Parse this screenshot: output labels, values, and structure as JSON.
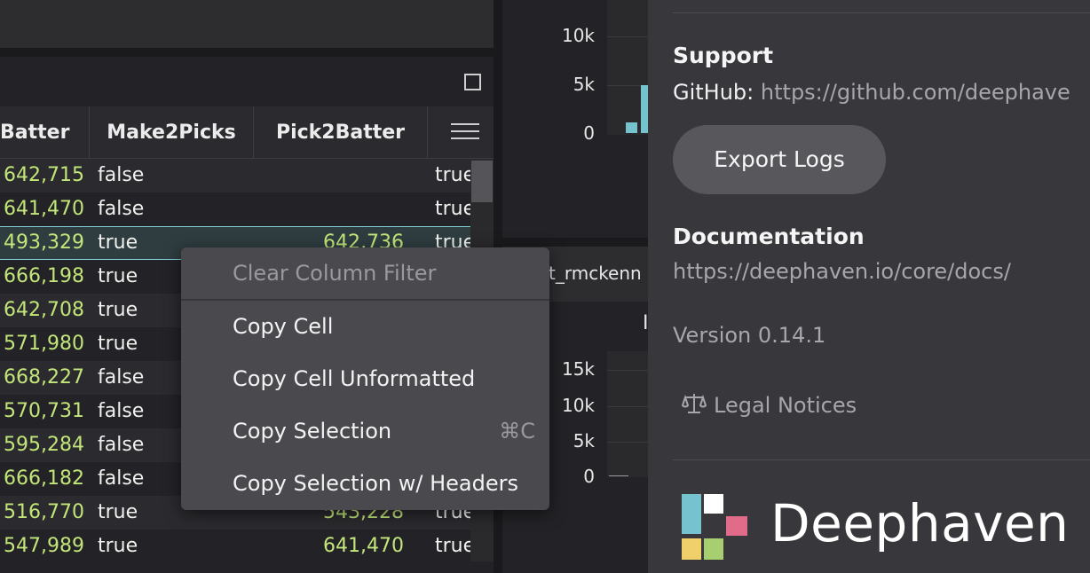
{
  "grid": {
    "columns": [
      "Batter",
      "Make2Picks",
      "Pick2Batter"
    ],
    "rows": [
      {
        "batter": "642,715",
        "make2picks": "false",
        "pick2batter": "",
        "last": "true"
      },
      {
        "batter": "641,470",
        "make2picks": "false",
        "pick2batter": "",
        "last": "true"
      },
      {
        "batter": "493,329",
        "make2picks": "true",
        "pick2batter": "642,736",
        "last": "true"
      },
      {
        "batter": "666,198",
        "make2picks": "true",
        "pick2batter": "",
        "last": ""
      },
      {
        "batter": "642,708",
        "make2picks": "true",
        "pick2batter": "",
        "last": ""
      },
      {
        "batter": "571,980",
        "make2picks": "true",
        "pick2batter": "",
        "last": ""
      },
      {
        "batter": "668,227",
        "make2picks": "false",
        "pick2batter": "",
        "last": ""
      },
      {
        "batter": "570,731",
        "make2picks": "false",
        "pick2batter": "",
        "last": ""
      },
      {
        "batter": "595,284",
        "make2picks": "false",
        "pick2batter": "",
        "last": ""
      },
      {
        "batter": "666,182",
        "make2picks": "false",
        "pick2batter": "",
        "last": ""
      },
      {
        "batter": "516,770",
        "make2picks": "true",
        "pick2batter": "543,228",
        "last": "true"
      },
      {
        "batter": "547,989",
        "make2picks": "true",
        "pick2batter": "641,470",
        "last": "true"
      }
    ]
  },
  "context_menu": {
    "items": [
      {
        "label": "Clear Column Filter",
        "disabled": true,
        "shortcut": ""
      },
      {
        "label": "Copy Cell",
        "disabled": false,
        "shortcut": ""
      },
      {
        "label": "Copy Cell Unformatted",
        "disabled": false,
        "shortcut": ""
      },
      {
        "label": "Copy Selection",
        "disabled": false,
        "shortcut": "⌘C"
      },
      {
        "label": "Copy Selection w/ Headers",
        "disabled": false,
        "shortcut": ""
      }
    ]
  },
  "charts": {
    "top": {
      "y_ticks": [
        "10k",
        "5k",
        "0"
      ]
    },
    "bottom": {
      "tab_label": "t_rmckenn",
      "title_fragment": "I",
      "y_ticks": [
        "15k",
        "10k",
        "5k",
        "0"
      ]
    }
  },
  "about": {
    "support_title": "Support",
    "github_label": "GitHub:",
    "github_url": "https://github.com/deephave",
    "export_logs": "Export Logs",
    "documentation_title": "Documentation",
    "docs_url": "https://deephaven.io/core/docs/",
    "version": "Version 0.14.1",
    "legal_notices": "Legal Notices",
    "brand": "Deephaven"
  },
  "colors": {
    "accent": "#76c3cf",
    "number_text": "#c2e67a",
    "logo": [
      "#76c3cf",
      "#ffffff",
      "#e06c8a",
      "#f0d06a",
      "#a8cf6f",
      "#3a3a3e"
    ]
  }
}
